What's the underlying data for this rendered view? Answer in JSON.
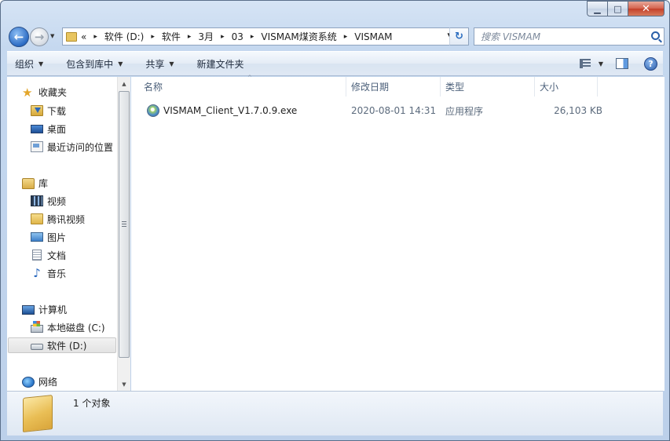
{
  "window": {
    "controls": {
      "minimize": "▁",
      "maximize": "□",
      "close": "✕"
    }
  },
  "nav": {
    "back_glyph": "←",
    "forward_glyph": "→",
    "dropdown_glyph": "▼",
    "refresh_glyph": "↻"
  },
  "address": {
    "overflow": "«",
    "crumbs": [
      "软件 (D:)",
      "软件",
      "3月",
      "03",
      "VISMAM煤资系统",
      "VISMAM"
    ],
    "separator": "▸",
    "dropdown_glyph": "▾"
  },
  "search": {
    "placeholder": "搜索 VISMAM"
  },
  "commands": {
    "organize": "组织",
    "include_in_library": "包含到库中",
    "share": "共享",
    "new_folder": "新建文件夹",
    "caret": "▼"
  },
  "sidebar": {
    "favorites": {
      "label": "收藏夹",
      "items": [
        "下载",
        "桌面",
        "最近访问的位置"
      ]
    },
    "libraries": {
      "label": "库",
      "items": [
        "视频",
        "腾讯视频",
        "图片",
        "文档",
        "音乐"
      ]
    },
    "computer": {
      "label": "计算机",
      "items": [
        "本地磁盘 (C:)",
        "软件 (D:)"
      ],
      "selected": "软件 (D:)"
    },
    "network": {
      "label": "网络"
    }
  },
  "columns": {
    "name": "名称",
    "modified": "修改日期",
    "type": "类型",
    "size": "大小",
    "sort_caret": "^"
  },
  "files": [
    {
      "name": "VISMAM_Client_V1.7.0.9.exe",
      "modified": "2020-08-01 14:31",
      "type": "应用程序",
      "size": "26,103 KB"
    }
  ],
  "details": {
    "count_text": "1 个对象"
  },
  "icons": {
    "favorites": "star-icon",
    "downloads": "download-folder-icon",
    "desktop": "desktop-icon",
    "recent": "recent-places-icon",
    "library": "library-icon",
    "video": "video-library-icon",
    "tencent_video": "folder-icon",
    "pictures": "pictures-icon",
    "documents": "documents-icon",
    "music": "music-icon",
    "computer": "computer-icon",
    "drive_c": "drive-c-icon",
    "drive_d": "drive-d-icon",
    "network": "network-icon",
    "file": "exe-app-icon"
  }
}
